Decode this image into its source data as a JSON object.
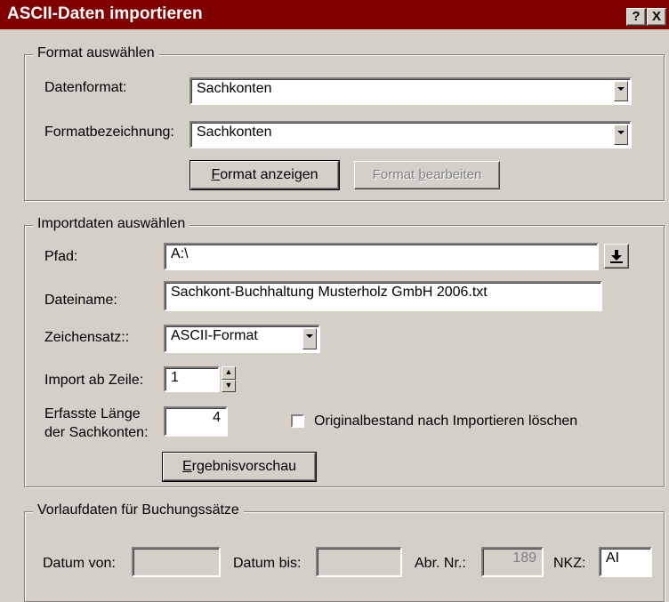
{
  "window": {
    "title": "ASCII-Daten importieren",
    "help_label": "?",
    "close_label": "X"
  },
  "format_group": {
    "legend": "Format auswählen",
    "datenformat_label": "Datenformat:",
    "datenformat_value": "Sachkonten",
    "formatbezeichnung_label": "Formatbezeichnung:",
    "formatbezeichnung_value": "Sachkonten",
    "format_anzeigen": {
      "accel": "F",
      "rest": "ormat anzeigen"
    },
    "format_bearbeiten": {
      "pre": "Format ",
      "accel": "b",
      "rest": "earbeiten"
    }
  },
  "import_group": {
    "legend": "Importdaten auswählen",
    "pfad_label": "Pfad:",
    "pfad_value": "A:\\",
    "dateiname_label": "Dateiname:",
    "dateiname_value": "Sachkont-Buchhaltung Musterholz GmbH 2006.txt",
    "zeichensatz_label": "Zeichensatz::",
    "zeichensatz_value": "ASCII-Format",
    "import_ab_label": "Import ab Zeile:",
    "import_ab_value": "1",
    "laenge_label_1": "Erfasste Länge",
    "laenge_label_2": "der Sachkonten:",
    "laenge_value": "4",
    "loeschen_label": "Originalbestand nach Importieren löschen",
    "loeschen_checked": false,
    "ergebnis": {
      "accel": "E",
      "rest": "rgebnisvorschau"
    }
  },
  "vorlauf_group": {
    "legend": "Vorlaufdaten für Buchungssätze",
    "datum_von_label": "Datum von:",
    "datum_von_value": "",
    "datum_bis_label": "Datum bis:",
    "datum_bis_value": "",
    "abr_label": "Abr. Nr.:",
    "abr_value": "189",
    "nkz_label": "NKZ:",
    "nkz_value": "AI"
  },
  "icons": {
    "help": "help-icon",
    "close": "close-icon",
    "browse": "browse-download-icon",
    "dropdown": "chevron-down-icon",
    "spin": "spinner-arrows-icon"
  },
  "colors": {
    "titlebar": "#800000",
    "face": "#d4d0c8"
  }
}
